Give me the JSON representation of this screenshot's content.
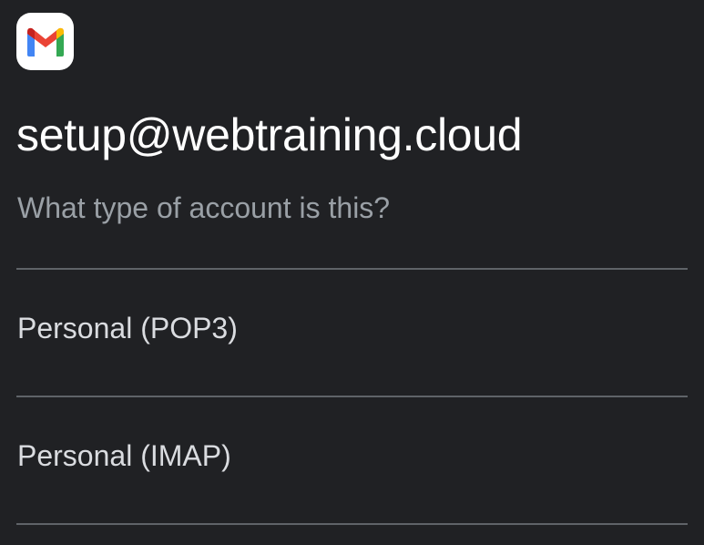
{
  "app": {
    "icon": "gmail-logo-icon",
    "colors": {
      "background": "#202124",
      "logo_red": "#EA4335",
      "logo_blue": "#4285F4",
      "logo_green": "#34A853",
      "logo_yellow": "#FBBC04",
      "logo_dark_red": "#C5221F"
    }
  },
  "account": {
    "email": "setup@webtraining.cloud"
  },
  "question": {
    "text": "What type of account is this?"
  },
  "options": [
    {
      "label": "Personal (POP3)"
    },
    {
      "label": "Personal (IMAP)"
    }
  ]
}
